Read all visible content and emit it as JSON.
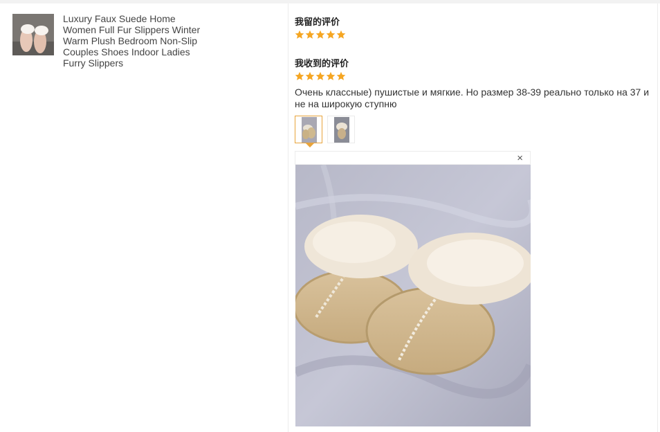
{
  "product": {
    "title": "Luxury Faux Suede Home Women Full Fur Slippers Winter Warm Plush Bedroom Non-Slip Couples Shoes Indoor Ladies Furry Slippers"
  },
  "my_review": {
    "heading": "我留的评价",
    "stars": 5
  },
  "received_review": {
    "heading": "我收到的评价",
    "stars": 5,
    "text": "Очень классные) пушистые и мягкие. Но размер 38-39 реально только на 37 и не на широкую ступню"
  },
  "gallery": {
    "thumb_count": 2,
    "selected_index": 0
  },
  "preview": {
    "close_label": "×"
  },
  "colors": {
    "star": "#f5a623",
    "accent_border": "#e8a33a",
    "divider": "#ececec"
  }
}
